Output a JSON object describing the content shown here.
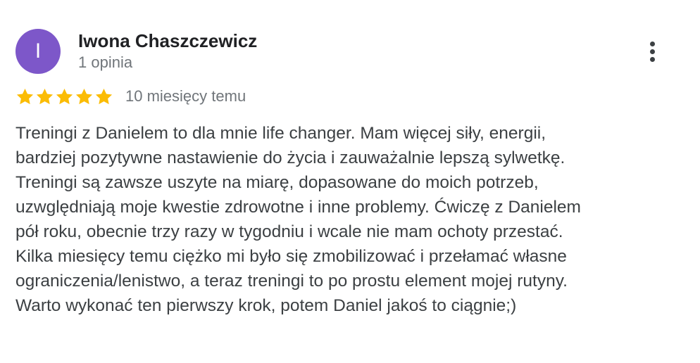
{
  "author": {
    "initial": "I",
    "name": "Iwona Chaszczewicz",
    "meta": "1 opinia",
    "avatar_color": "#7d57c9"
  },
  "rating": {
    "stars": 5,
    "max_stars": 5,
    "star_color": "#fbbc04",
    "date": "10 miesięcy temu"
  },
  "menu": {
    "icon": "more-vertical-icon"
  },
  "review": {
    "lines": [
      "Treningi z Danielem to dla mnie life changer. Mam więcej siły, energii,",
      "bardziej pozytywne nastawienie do życia i zauważalnie lepszą sylwetkę.",
      "Treningi są zawsze uszyte na miarę, dopasowane do moich potrzeb,",
      "uzwględniają moje kwestie zdrowotne i inne problemy. Ćwiczę z Danielem",
      "pół roku, obecnie trzy razy w tygodniu i wcale nie mam ochoty przestać.",
      "Kilka miesięcy temu ciężko mi było się zmobilizować i przełamać własne",
      "ograniczenia/lenistwo, a teraz treningi to po prostu element mojej rutyny.",
      "Warto wykonać ten pierwszy krok, potem Daniel jakoś to ciągnie;)"
    ]
  }
}
